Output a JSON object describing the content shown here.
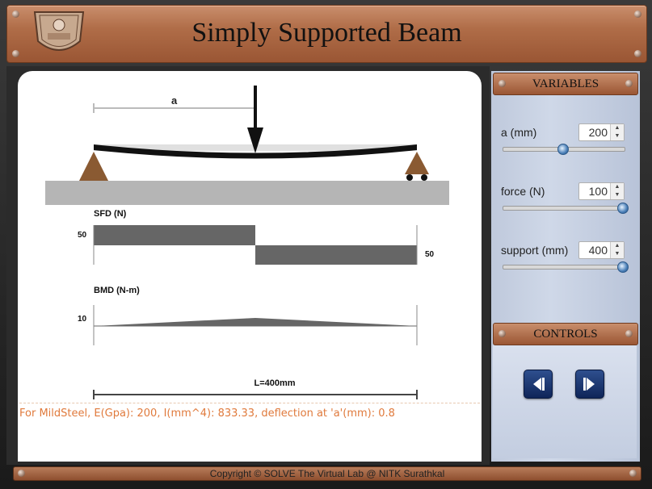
{
  "header": {
    "title": "Simply Supported Beam"
  },
  "sim": {
    "a_label": "a",
    "sfd_title": "SFD (N)",
    "sfd_pos_value": "50",
    "sfd_neg_value": "50",
    "bmd_title": "BMD (N-m)",
    "bmd_value": "10",
    "length_label": "L=400mm",
    "info": "For MildSteel, E(Gpa): 200, I(mm^4): 833.33, deflection at 'a'(mm): 0.8"
  },
  "variables": {
    "heading": "VARIABLES",
    "a": {
      "label": "a (mm)",
      "value": "200",
      "slider_fraction": 0.5
    },
    "force": {
      "label": "force (N)",
      "value": "100",
      "slider_fraction": 1.0
    },
    "support": {
      "label": "support (mm)",
      "value": "400",
      "slider_fraction": 1.0
    }
  },
  "controls": {
    "heading": "CONTROLS",
    "prev_icon": "step-back-icon",
    "next_icon": "step-forward-icon"
  },
  "footer": {
    "text": "Copyright © SOLVE The Virtual Lab @ NITK Surathkal"
  },
  "colors": {
    "header_copper": "#b06d48",
    "info_orange": "#e07a3c",
    "slider_blue": "#4a7fb8",
    "button_navy": "#1e3a75"
  }
}
